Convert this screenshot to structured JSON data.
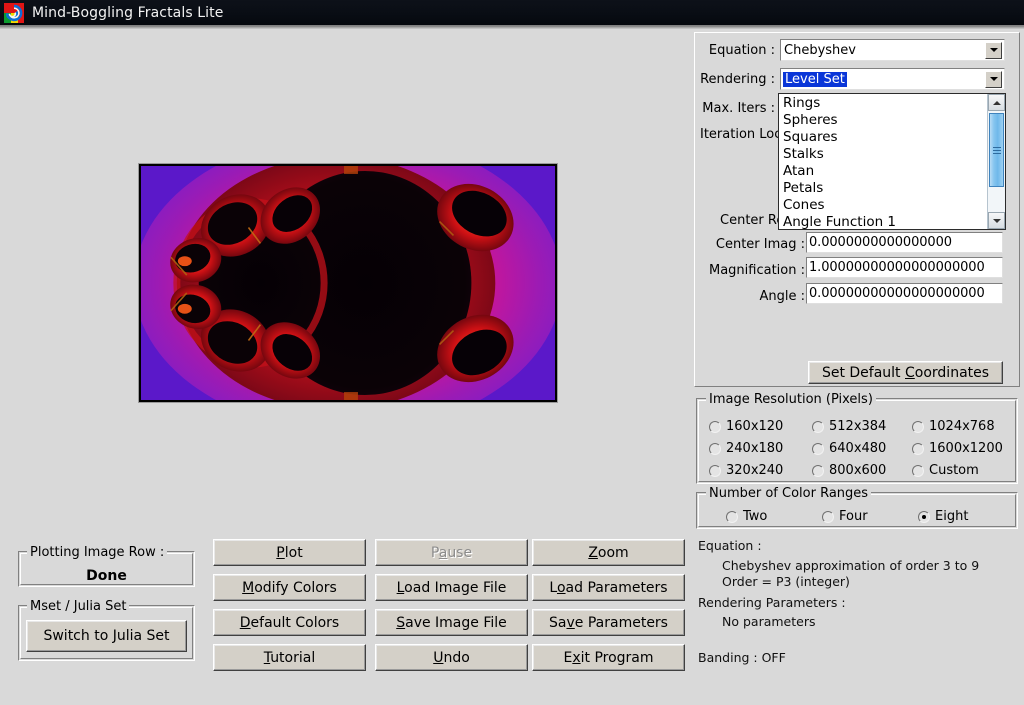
{
  "window": {
    "title": "Mind-Boggling Fractals Lite",
    "icon": "spiral-logo-icon"
  },
  "parameters": {
    "equation_label": "Equation :",
    "equation_value": "Chebyshev",
    "rendering_label": "Rendering :",
    "rendering_value": "Level Set",
    "max_iters_label": "Max. Iters :",
    "iteration_loc_label": "Iteration Loc",
    "center_real_label": "Center Re",
    "center_imag_label": "Center Imag :",
    "center_imag_value": "0.0000000000000000",
    "magnification_label": "Magnification :",
    "magnification_value": "1.00000000000000000000",
    "angle_label": "Angle :",
    "angle_value": "0.00000000000000000000",
    "set_default_coords_button": "Set Default Coordinates",
    "set_default_coords_accel": "C"
  },
  "rendering_dropdown": {
    "open": true,
    "items": [
      "Rings",
      "Spheres",
      "Squares",
      "Stalks",
      "Atan",
      "Petals",
      "Cones",
      "Angle Function 1"
    ],
    "scroll_up_icon": "arrow-up-icon",
    "scroll_down_icon": "arrow-down-icon"
  },
  "image_resolution": {
    "title": "Image Resolution (Pixels)",
    "options": [
      {
        "label": "160x120",
        "checked": false
      },
      {
        "label": "240x180",
        "checked": false
      },
      {
        "label": "320x240",
        "checked": false
      },
      {
        "label": "512x384",
        "checked": false
      },
      {
        "label": "640x480",
        "checked": false
      },
      {
        "label": "800x600",
        "checked": false
      },
      {
        "label": "1024x768",
        "checked": false
      },
      {
        "label": "1600x1200",
        "checked": false
      },
      {
        "label": "Custom",
        "checked": false
      }
    ]
  },
  "color_ranges": {
    "title": "Number of Color Ranges",
    "options": [
      {
        "label": "Two",
        "checked": false
      },
      {
        "label": "Four",
        "checked": false
      },
      {
        "label": "Eight",
        "checked": true
      }
    ]
  },
  "info": {
    "equation_heading": "Equation :",
    "equation_desc_1": "Chebyshev approximation of order 3 to 9",
    "equation_desc_2": "Order = P3 (integer)",
    "rendering_heading": "Rendering Parameters :",
    "rendering_desc": "No parameters",
    "banding": "Banding :  OFF"
  },
  "plotting_status": {
    "title": "Plotting Image Row :",
    "value": "Done"
  },
  "mset_julia": {
    "title": "Mset / Julia Set",
    "button": "Switch to Julia Set"
  },
  "buttons": [
    {
      "label": "Plot",
      "accel": "P",
      "disabled": false
    },
    {
      "label": "Pause",
      "accel": "a",
      "disabled": true
    },
    {
      "label": "Zoom",
      "accel": "Z",
      "disabled": false
    },
    {
      "label": "Modify Colors",
      "accel": "M",
      "disabled": false
    },
    {
      "label": "Load Image File",
      "accel": "L",
      "disabled": false
    },
    {
      "label": "Load Parameters",
      "accel": "o",
      "disabled": false
    },
    {
      "label": "Default Colors",
      "accel": "D",
      "disabled": false
    },
    {
      "label": "Save Image File",
      "accel": "S",
      "disabled": false
    },
    {
      "label": "Save Parameters",
      "accel": "v",
      "disabled": false
    },
    {
      "label": "Tutorial",
      "accel": "T",
      "disabled": false
    },
    {
      "label": "Undo",
      "accel": "U",
      "disabled": false
    },
    {
      "label": "Exit Program",
      "accel": "x",
      "disabled": false
    }
  ],
  "colors": {
    "window_background": "#d9d9d9",
    "titlebar": "#0a0e15",
    "selection_blue": "#0a36d8",
    "fractal_purple": "#7b25d8",
    "fractal_magenta": "#e01a86",
    "fractal_red": "#c41218",
    "fractal_black": "#050005"
  }
}
